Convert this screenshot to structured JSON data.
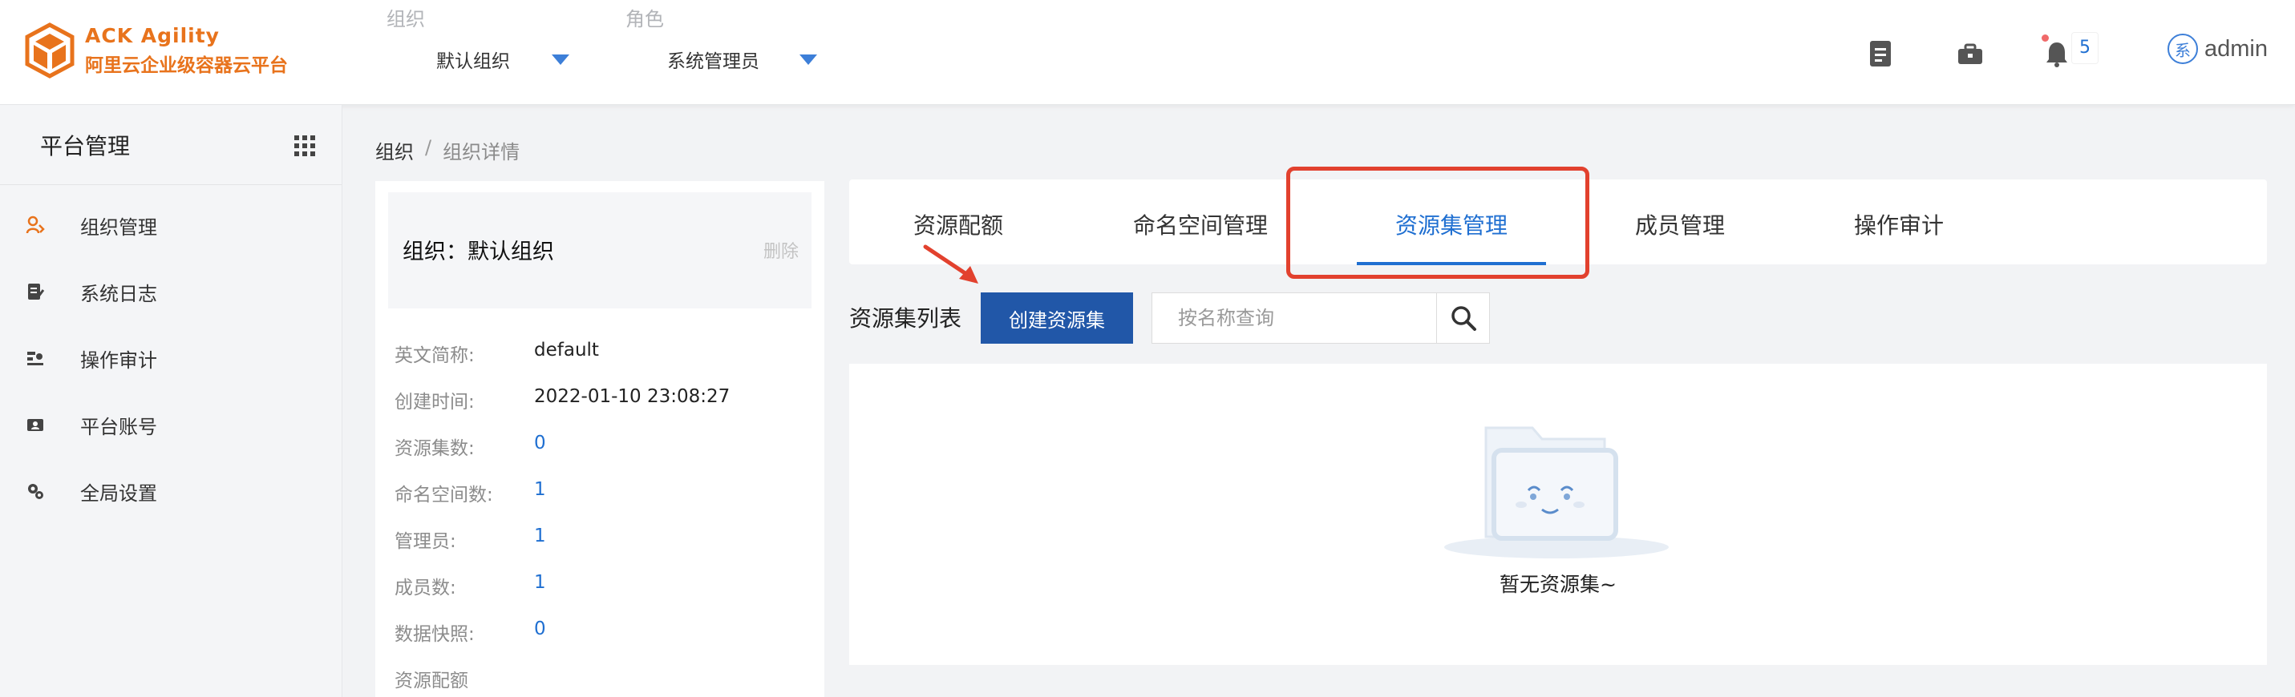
{
  "header": {
    "logo_line1": "ACK Agility",
    "logo_line2": "阿里云企业级容器云平台",
    "org_label": "组织",
    "org_value": "默认组织",
    "role_label": "角色",
    "role_value": "系统管理员",
    "notification_count": "5",
    "avatar_char": "系",
    "username": "admin"
  },
  "sidebar": {
    "title": "平台管理",
    "items": [
      {
        "label": "组织管理",
        "icon": "org-icon"
      },
      {
        "label": "系统日志",
        "icon": "log-icon"
      },
      {
        "label": "操作审计",
        "icon": "audit-icon"
      },
      {
        "label": "平台账号",
        "icon": "account-icon"
      },
      {
        "label": "全局设置",
        "icon": "settings-icon"
      }
    ]
  },
  "breadcrumb": {
    "root": "组织",
    "sep": "/",
    "current": "组织详情"
  },
  "org": {
    "title": "组织：默认组织",
    "delete_label": "删除",
    "fields": [
      {
        "key": "英文简称:",
        "value": "default"
      },
      {
        "key": "创建时间:",
        "value": "2022-01-10 23:08:27"
      },
      {
        "key": "资源集数:",
        "value": "0"
      },
      {
        "key": "命名空间数:",
        "value": "1"
      },
      {
        "key": "管理员:",
        "value": "1"
      },
      {
        "key": "成员数:",
        "value": "1"
      },
      {
        "key": "数据快照:",
        "value": "0"
      },
      {
        "key": "资源配额",
        "value": ""
      }
    ]
  },
  "tabs": [
    {
      "label": "资源配额"
    },
    {
      "label": "命名空间管理"
    },
    {
      "label": "资源集管理",
      "active": true
    },
    {
      "label": "成员管理"
    },
    {
      "label": "操作审计"
    }
  ],
  "toolbar": {
    "list_title": "资源集列表",
    "create_label": "创建资源集",
    "search_placeholder": "按名称查询"
  },
  "empty": {
    "text": "暂无资源集~"
  },
  "colors": {
    "brand": "#e8731c",
    "primary": "#1f6fd1",
    "button": "#2157a8",
    "highlight": "#e2412e"
  }
}
